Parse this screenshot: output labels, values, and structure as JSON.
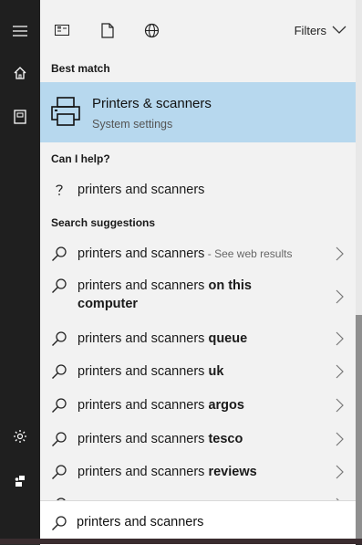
{
  "topbar": {
    "icons": [
      "app-icon",
      "document-icon",
      "globe-icon"
    ],
    "filters_label": "Filters"
  },
  "sections": {
    "best_match": "Best match",
    "can_i_help": "Can I help?",
    "search_suggestions": "Search suggestions"
  },
  "best_match": {
    "title": "Printers & scanners",
    "subtitle": "System settings",
    "icon": "printer-icon",
    "highlight_color": "#b7d8ee"
  },
  "help": {
    "text": "printers and scanners",
    "icon": "question-icon"
  },
  "suggestions": [
    {
      "prefix": "printers and scanners",
      "bold": "",
      "suffix": " - See web results"
    },
    {
      "prefix": "printers and scanners ",
      "bold": "on this computer",
      "suffix": ""
    },
    {
      "prefix": "printers and scanners ",
      "bold": "queue",
      "suffix": ""
    },
    {
      "prefix": "printers and scanners ",
      "bold": "uk",
      "suffix": ""
    },
    {
      "prefix": "printers and scanners ",
      "bold": "argos",
      "suffix": ""
    },
    {
      "prefix": "printers and scanners ",
      "bold": "tesco",
      "suffix": ""
    },
    {
      "prefix": "printers and scanners ",
      "bold": "reviews",
      "suffix": ""
    }
  ],
  "search": {
    "value": "printers and scanners"
  },
  "rail": {
    "icons": [
      "hamburger-icon",
      "home-icon",
      "documents-icon",
      "settings-icon",
      "user-icon"
    ]
  }
}
